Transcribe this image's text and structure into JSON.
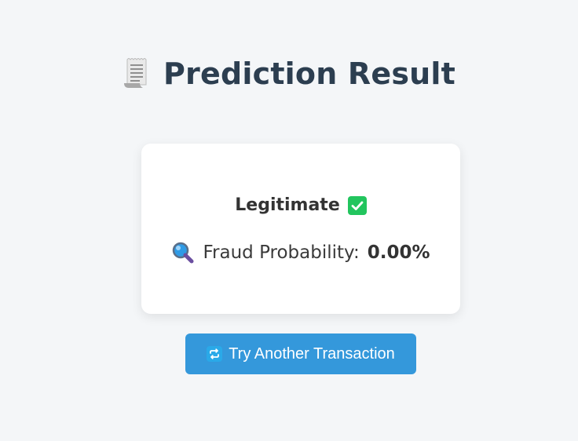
{
  "header": {
    "title": "Prediction Result",
    "icon": "receipt-icon"
  },
  "result": {
    "status_label": "Legitimate",
    "status_icon": "check-mark-icon",
    "probability_icon": "magnifier-icon",
    "probability_label": "Fraud Probability:",
    "probability_value": "0.00%"
  },
  "actions": {
    "retry_label": "Try Another Transaction",
    "retry_icon": "repeat-icon"
  },
  "colors": {
    "background": "#f4f6f8",
    "title": "#2c3e50",
    "button": "#3498db",
    "check": "#22c55e"
  }
}
